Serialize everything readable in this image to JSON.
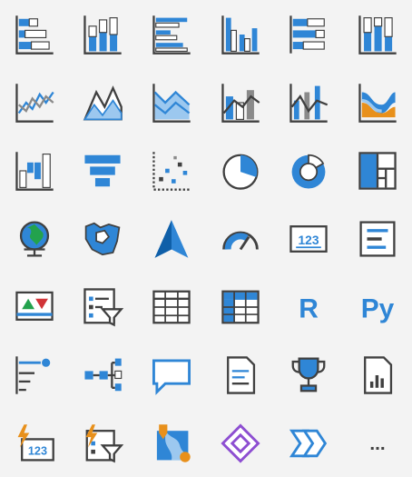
{
  "visuals": [
    {
      "icon": "stacked-bar-chart-icon"
    },
    {
      "icon": "stacked-column-chart-icon"
    },
    {
      "icon": "clustered-bar-chart-icon"
    },
    {
      "icon": "clustered-column-chart-icon"
    },
    {
      "icon": "100-percent-stacked-bar-chart-icon"
    },
    {
      "icon": "100-percent-stacked-column-chart-icon"
    },
    {
      "icon": "line-chart-icon"
    },
    {
      "icon": "area-chart-icon"
    },
    {
      "icon": "stacked-area-chart-icon"
    },
    {
      "icon": "line-and-stacked-column-chart-icon"
    },
    {
      "icon": "line-and-clustered-column-chart-icon"
    },
    {
      "icon": "ribbon-chart-icon"
    },
    {
      "icon": "waterfall-chart-icon"
    },
    {
      "icon": "funnel-icon"
    },
    {
      "icon": "scatter-chart-icon"
    },
    {
      "icon": "pie-chart-icon"
    },
    {
      "icon": "donut-chart-icon"
    },
    {
      "icon": "treemap-icon"
    },
    {
      "icon": "map-globe-icon"
    },
    {
      "icon": "filled-map-icon"
    },
    {
      "icon": "azure-map-icon"
    },
    {
      "icon": "gauge-icon"
    },
    {
      "icon": "card-icon",
      "label": "123"
    },
    {
      "icon": "multi-row-card-icon"
    },
    {
      "icon": "kpi-icon"
    },
    {
      "icon": "slicer-icon"
    },
    {
      "icon": "table-icon"
    },
    {
      "icon": "matrix-icon"
    },
    {
      "icon": "r-script-visual-icon",
      "label": "R"
    },
    {
      "icon": "python-visual-icon",
      "label": "Py"
    },
    {
      "icon": "key-influencers-icon"
    },
    {
      "icon": "decomposition-tree-icon"
    },
    {
      "icon": "qa-icon"
    },
    {
      "icon": "smart-narrative-icon"
    },
    {
      "icon": "goals-trophy-icon"
    },
    {
      "icon": "paginated-report-icon"
    },
    {
      "icon": "new-card-icon",
      "label": "123"
    },
    {
      "icon": "new-slicer-icon"
    },
    {
      "icon": "arcgis-map-icon"
    },
    {
      "icon": "shape-map-icon"
    },
    {
      "icon": "power-apps-icon"
    },
    {
      "icon": "power-automate-icon"
    },
    {
      "icon": "more-visuals-icon",
      "label": "..."
    }
  ],
  "colors": {
    "blue": "#2f86d6",
    "lightBlue": "#9cc8ef",
    "gray": "#8a8a8a",
    "dark": "#404040",
    "green": "#23a24d",
    "red": "#d13438",
    "orange": "#e8901b",
    "purple": "#8d4ed1"
  }
}
